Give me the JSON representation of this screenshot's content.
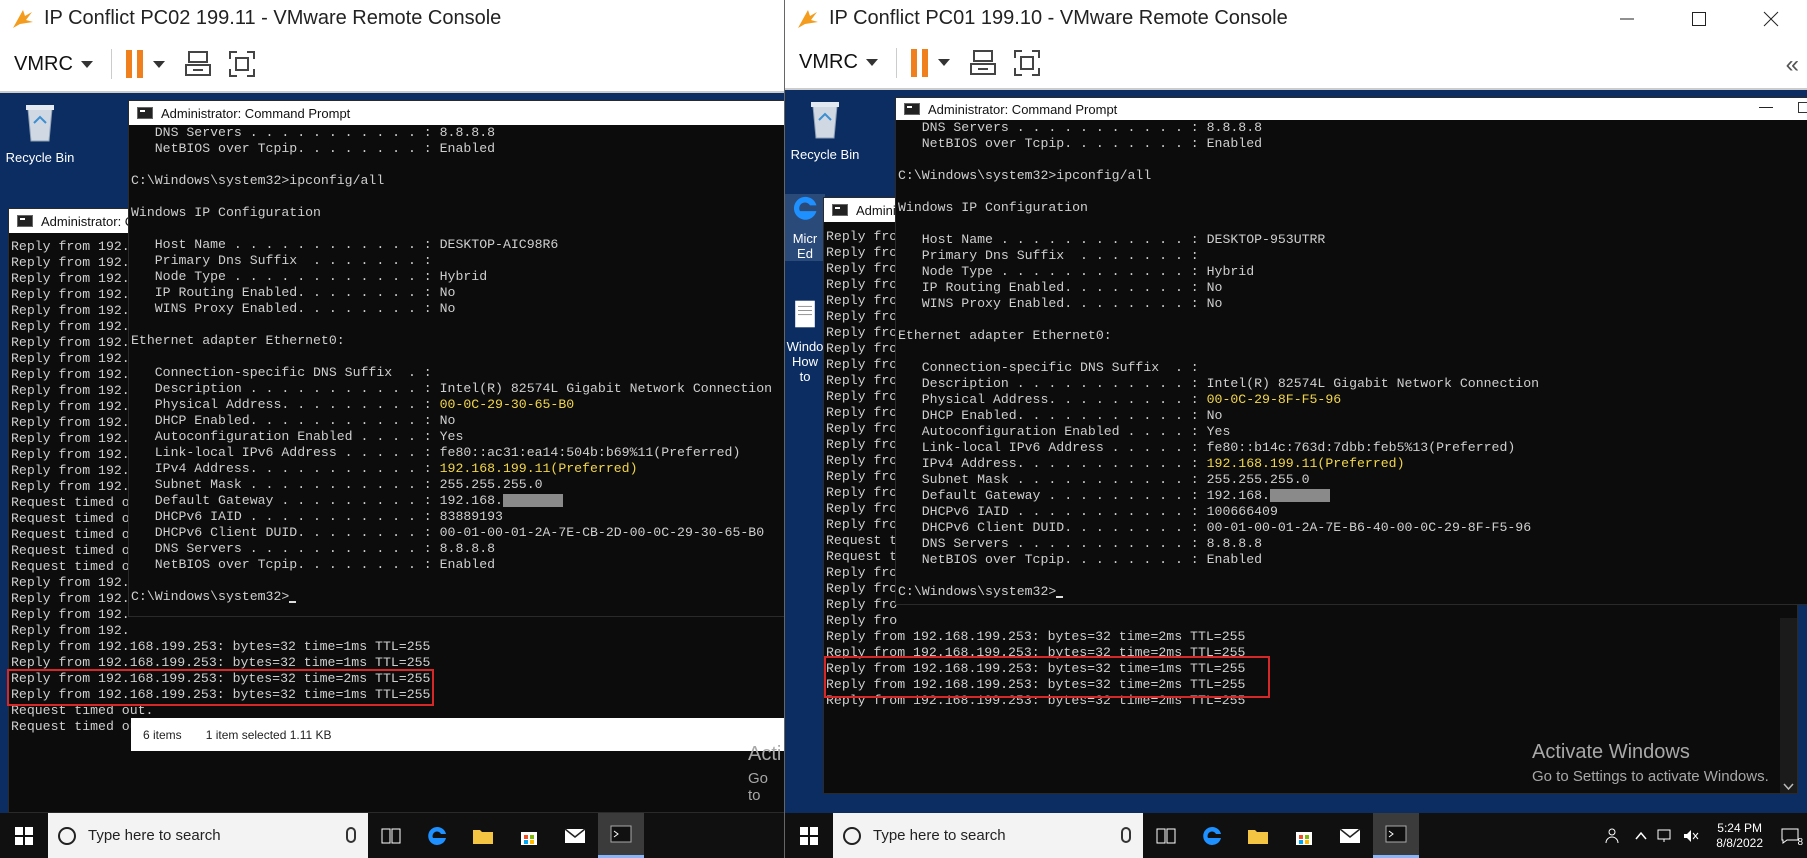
{
  "left_window": {
    "title": "IP Conflict PC02 199.11 - VMware Remote Console",
    "toolbar": {
      "vmrc_label": "VMRC"
    },
    "desktop_icons": [
      {
        "label": "Recycle Bin"
      }
    ],
    "cmd_main": {
      "title": "Administrator: Command Prompt",
      "lines": [
        {
          "t": "   DNS Servers . . . . . . . . . . . : 8.8.8.8"
        },
        {
          "t": "   NetBIOS over Tcpip. . . . . . . . : Enabled"
        },
        {
          "t": ""
        },
        {
          "t": "C:\\Windows\\system32>ipconfig/all"
        },
        {
          "t": ""
        },
        {
          "t": "Windows IP Configuration"
        },
        {
          "t": ""
        },
        {
          "t": "   Host Name . . . . . . . . . . . . : DESKTOP-AIC98R6"
        },
        {
          "t": "   Primary Dns Suffix  . . . . . . . :"
        },
        {
          "t": "   Node Type . . . . . . . . . . . . : Hybrid"
        },
        {
          "t": "   IP Routing Enabled. . . . . . . . : No"
        },
        {
          "t": "   WINS Proxy Enabled. . . . . . . . : No"
        },
        {
          "t": ""
        },
        {
          "t": "Ethernet adapter Ethernet0:"
        },
        {
          "t": ""
        },
        {
          "t": "   Connection-specific DNS Suffix  . :"
        },
        {
          "t": "   Description . . . . . . . . . . . : Intel(R) 82574L Gigabit Network Connection"
        },
        {
          "t": "   Physical Address. . . . . . . . . : ",
          "y": "00-0C-29-30-65-B0"
        },
        {
          "t": "   DHCP Enabled. . . . . . . . . . . : No"
        },
        {
          "t": "   Autoconfiguration Enabled . . . . : Yes"
        },
        {
          "t": "   Link-local IPv6 Address . . . . . : fe80::ac31:ea14:504b:b69%11(Preferred)"
        },
        {
          "t": "   IPv4 Address. . . . . . . . . . . : ",
          "y": "192.168.199.11(Preferred)"
        },
        {
          "t": "   Subnet Mask . . . . . . . . . . . : 255.255.255.0"
        },
        {
          "t": "   Default Gateway . . . . . . . . . : 192.168.",
          "r": true
        },
        {
          "t": "   DHCPv6 IAID . . . . . . . . . . . : 83889193"
        },
        {
          "t": "   DHCPv6 Client DUID. . . . . . . . : 00-01-00-01-2A-7E-CB-2D-00-0C-29-30-65-B0"
        },
        {
          "t": "   DNS Servers . . . . . . . . . . . : 8.8.8.8"
        },
        {
          "t": "   NetBIOS over Tcpip. . . . . . . . : Enabled"
        },
        {
          "t": ""
        },
        {
          "t": "C:\\Windows\\system32>",
          "c": true
        }
      ]
    },
    "cmd_back": {
      "title": "Administrator: Co",
      "lines": [
        "Reply from 192.",
        "Reply from 192.",
        "Reply from 192.",
        "Reply from 192.",
        "Reply from 192.",
        "Reply from 192.",
        "Reply from 192.",
        "Reply from 192.",
        "Reply from 192.",
        "Reply from 192.",
        "Reply from 192.",
        "Reply from 192.",
        "Reply from 192.",
        "Reply from 192.",
        "Reply from 192.",
        "Reply from 192.",
        "Request timed o",
        "Request timed o",
        "Request timed o",
        "Request timed o",
        "Request timed o",
        "Reply from 192.",
        "Reply from 192.",
        "Reply from 192.",
        "Reply from 192.",
        "Reply from 192.168.199.253: bytes=32 time=1ms TTL=255",
        "Reply from 192.168.199.253: bytes=32 time=1ms TTL=255",
        "Reply from 192.168.199.253: bytes=32 time=2ms TTL=255",
        "Reply from 192.168.199.253: bytes=32 time=1ms TTL=255",
        "Request timed out.",
        "Request timed out."
      ]
    },
    "explorer_status": {
      "items": "6 items",
      "selected": "1 item selected  1.11 KB"
    },
    "activate_partial": {
      "line1": "Acti",
      "line2": "Go to"
    },
    "taskbar": {
      "search_placeholder": "Type here to search"
    }
  },
  "right_window": {
    "title": "IP Conflict PC01 199.10 - VMware Remote Console",
    "toolbar": {
      "vmrc_label": "VMRC"
    },
    "desktop_icons": [
      {
        "label": "Recycle Bin"
      },
      {
        "label": "Micr Ed"
      },
      {
        "label": "Windo How to"
      }
    ],
    "cmd_main": {
      "title": "Administrator: Command Prompt",
      "lines": [
        {
          "t": "   DNS Servers . . . . . . . . . . . : 8.8.8.8"
        },
        {
          "t": "   NetBIOS over Tcpip. . . . . . . . : Enabled"
        },
        {
          "t": ""
        },
        {
          "t": "C:\\Windows\\system32>ipconfig/all"
        },
        {
          "t": ""
        },
        {
          "t": "Windows IP Configuration"
        },
        {
          "t": ""
        },
        {
          "t": "   Host Name . . . . . . . . . . . . : DESKTOP-953UTRR"
        },
        {
          "t": "   Primary Dns Suffix  . . . . . . . :"
        },
        {
          "t": "   Node Type . . . . . . . . . . . . : Hybrid"
        },
        {
          "t": "   IP Routing Enabled. . . . . . . . : No"
        },
        {
          "t": "   WINS Proxy Enabled. . . . . . . . : No"
        },
        {
          "t": ""
        },
        {
          "t": "Ethernet adapter Ethernet0:"
        },
        {
          "t": ""
        },
        {
          "t": "   Connection-specific DNS Suffix  . :"
        },
        {
          "t": "   Description . . . . . . . . . . . : Intel(R) 82574L Gigabit Network Connection"
        },
        {
          "t": "   Physical Address. . . . . . . . . : ",
          "y": "00-0C-29-8F-F5-96"
        },
        {
          "t": "   DHCP Enabled. . . . . . . . . . . : No"
        },
        {
          "t": "   Autoconfiguration Enabled . . . . : Yes"
        },
        {
          "t": "   Link-local IPv6 Address . . . . . : fe80::b14c:763d:7dbb:feb5%13(Preferred)"
        },
        {
          "t": "   IPv4 Address. . . . . . . . . . . : ",
          "y": "192.168.199.11(Preferred)"
        },
        {
          "t": "   Subnet Mask . . . . . . . . . . . : 255.255.255.0"
        },
        {
          "t": "   Default Gateway . . . . . . . . . : 192.168.",
          "r": true
        },
        {
          "t": "   DHCPv6 IAID . . . . . . . . . . . : 100666409"
        },
        {
          "t": "   DHCPv6 Client DUID. . . . . . . . : 00-01-00-01-2A-7E-B6-40-00-0C-29-8F-F5-96"
        },
        {
          "t": "   DNS Servers . . . . . . . . . . . : 8.8.8.8"
        },
        {
          "t": "   NetBIOS over Tcpip. . . . . . . . : Enabled"
        },
        {
          "t": ""
        },
        {
          "t": "C:\\Windows\\system32>",
          "c": true
        }
      ]
    },
    "cmd_back": {
      "title": "Admini",
      "lines": [
        "Reply fro",
        "Reply fro",
        "Reply fro",
        "Reply fro",
        "Reply fro",
        "Reply fro",
        "Reply fro",
        "Reply fro",
        "Reply fro",
        "Reply fro",
        "Reply fro",
        "Reply fro",
        "Reply fro",
        "Reply fro",
        "Reply fro",
        "Reply fro",
        "Reply fro",
        "Reply fro",
        "Reply fro",
        "Request t",
        "Request t",
        "Reply fro",
        "Reply fro",
        "Reply fro",
        "Reply fro",
        "Reply from 192.168.199.253: bytes=32 time=2ms TTL=255",
        "Reply from 192.168.199.253: bytes=32 time=2ms TTL=255",
        "Reply from 192.168.199.253: bytes=32 time=1ms TTL=255",
        "Reply from 192.168.199.253: bytes=32 time=2ms TTL=255",
        "Reply from 192.168.199.253: bytes=32 time=2ms TTL=255"
      ]
    },
    "activate": {
      "line1": "Activate Windows",
      "line2": "Go to Settings to activate Windows."
    },
    "taskbar": {
      "search_placeholder": "Type here to search",
      "time": "5:24 PM",
      "date": "8/8/2022",
      "notification_count": "8"
    }
  }
}
